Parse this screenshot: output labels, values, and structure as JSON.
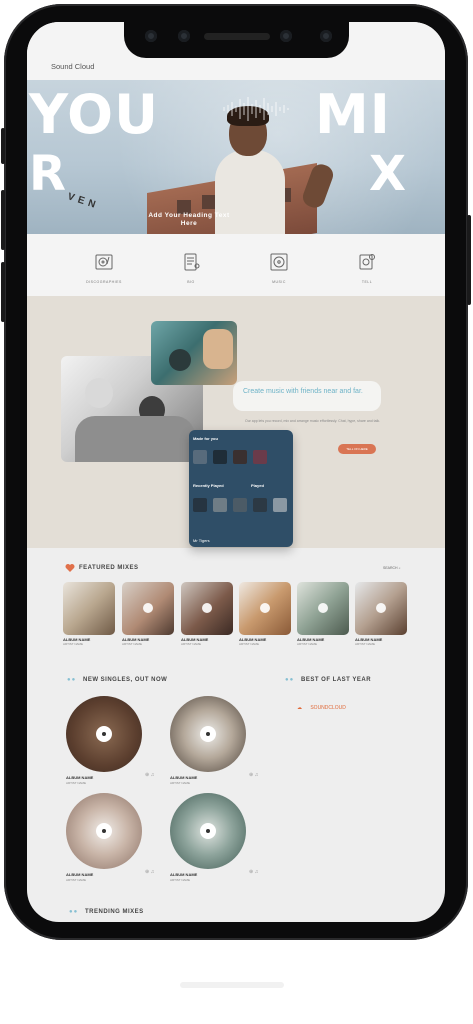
{
  "app": {
    "brand": "Sound Cloud"
  },
  "hero": {
    "big_left_1": "YOU",
    "big_left_2": "R",
    "big_right_1": "MI",
    "big_right_2": "X",
    "rotated": "VEN",
    "heading_line1": "Add Your Heading Text",
    "heading_line2": "Here"
  },
  "icons": [
    {
      "name": "turntable-icon",
      "label": "DISCOGRAPHIES"
    },
    {
      "name": "tablet-icon",
      "label": "BIO"
    },
    {
      "name": "vinyl-icon",
      "label": "MUSIC"
    },
    {
      "name": "gear-music-icon",
      "label": "TELL"
    }
  ],
  "feature": {
    "bubble_text": "Create music with friends near and far.",
    "subtext": "Our app lets you record, mix and arrange music effortlessly. Chat, hype, share and talk.",
    "cta": "TELL ON HERE",
    "mock_made_for_you": "Made for you",
    "mock_recent": "Recently Played",
    "mock_played": "Played",
    "mock_footer": "Mr Tigers"
  },
  "featured": {
    "title": "FEATURED MIXES",
    "search": "SEARCH",
    "cards": [
      {
        "title": "ALBUM NAME",
        "sub": "ARTIST NAME"
      },
      {
        "title": "ALBUM NAME",
        "sub": "ARTIST NAME"
      },
      {
        "title": "ALBUM NAME",
        "sub": "ARTIST NAME"
      },
      {
        "title": "ALBUM NAME",
        "sub": "ARTIST NAME"
      },
      {
        "title": "ALBUM NAME",
        "sub": "ARTIST NAME"
      },
      {
        "title": "ALBUM NAME",
        "sub": "ARTIST NAME"
      }
    ]
  },
  "singles": {
    "title": "NEW SINGLES, OUT NOW",
    "items": [
      {
        "title": "ALBUM NAME",
        "sub": "ARTIST NAME"
      },
      {
        "title": "ALBUM NAME",
        "sub": "ARTIST NAME"
      },
      {
        "title": "ALBUM NAME",
        "sub": "ARTIST NAME"
      },
      {
        "title": "ALBUM NAME",
        "sub": "ARTIST NAME"
      }
    ]
  },
  "best": {
    "title": "BEST OF LAST YEAR",
    "embed": "SOUNDCLOUD"
  },
  "trending": {
    "title": "TRENDING MIXES"
  },
  "colors": {
    "accent": "#d97554",
    "teal": "#86bfd2",
    "bezel": "#0b0b0c"
  }
}
